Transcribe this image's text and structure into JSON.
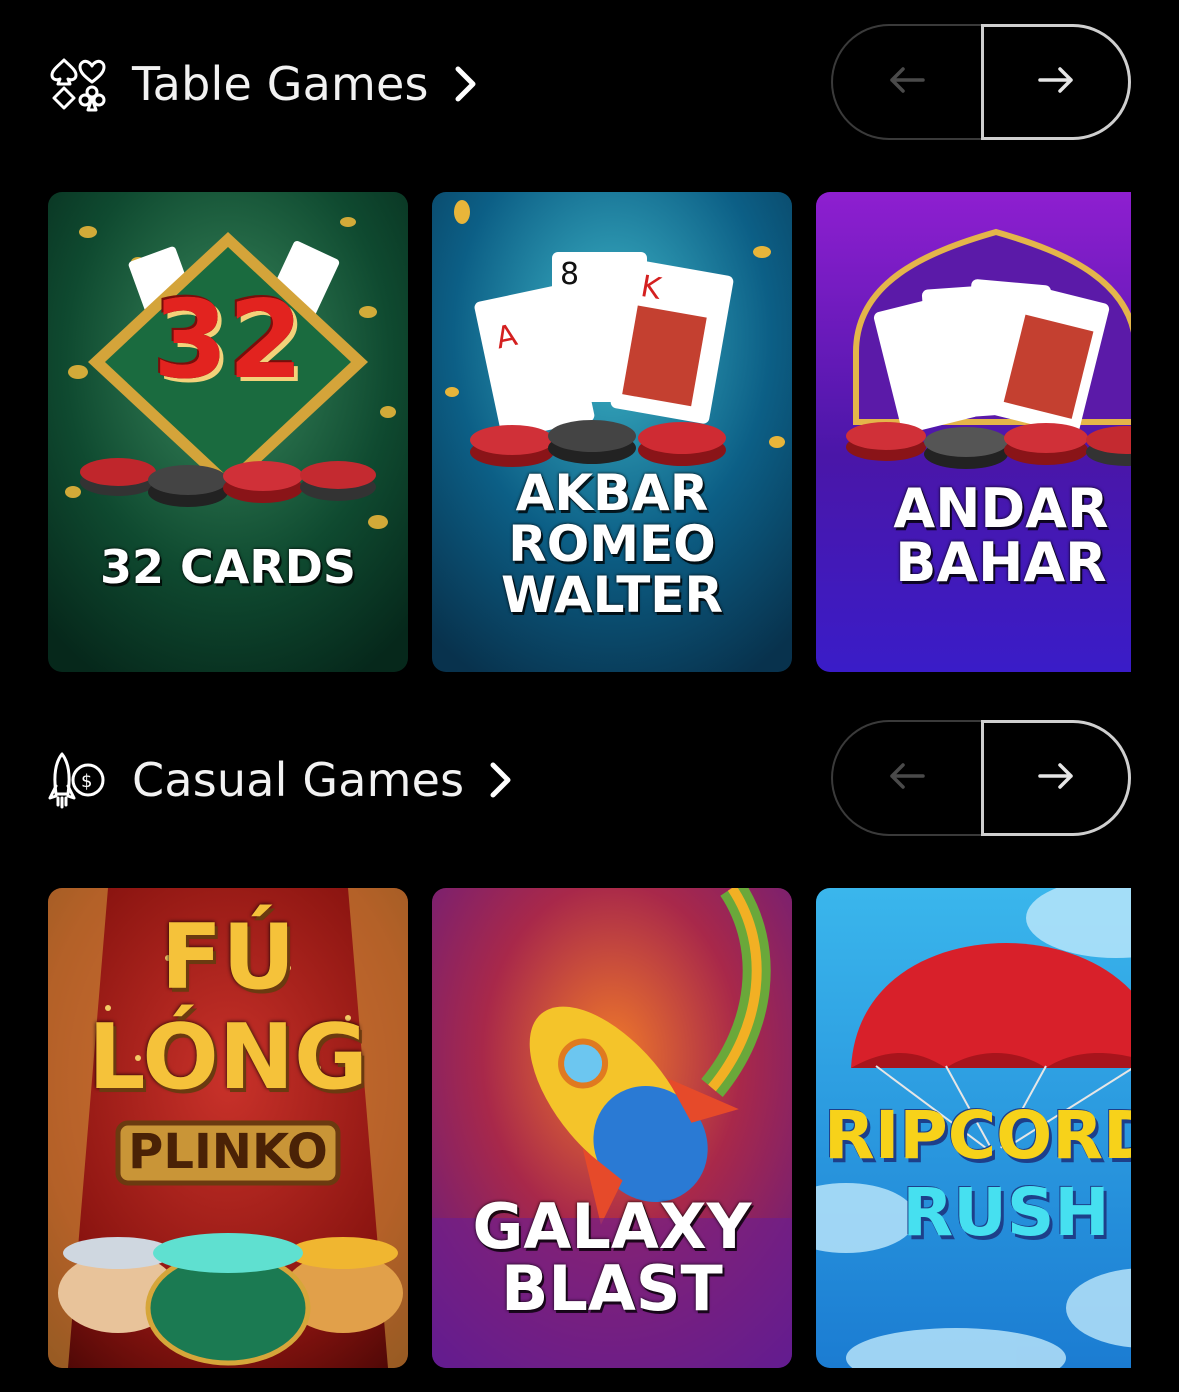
{
  "sections": [
    {
      "title": "Table Games",
      "icon": "card-suits-icon",
      "games": [
        {
          "title": "32 CARDS",
          "badge": "32"
        },
        {
          "title": "AKBAR ROMEO WALTER"
        },
        {
          "title": "ANDAR BAHAR"
        }
      ]
    },
    {
      "title": "Casual Games",
      "icon": "rocket-dollar-icon",
      "games": [
        {
          "title": "FÚ LÓNG PLINKO",
          "line1": "FÚ",
          "line2": "LÓNG",
          "line3": "PLINKO"
        },
        {
          "title": "GALAXY BLAST"
        },
        {
          "title": "RIPCORD RUSH",
          "line1": "RIPCORD",
          "line2": "RUSH"
        }
      ]
    }
  ],
  "nav": {
    "prev_icon": "arrow-left-icon",
    "next_icon": "arrow-right-icon"
  },
  "colors": {
    "background": "#000000",
    "nav_border_disabled": "#3a3a3a",
    "nav_border_active": "#cfcfcf"
  }
}
